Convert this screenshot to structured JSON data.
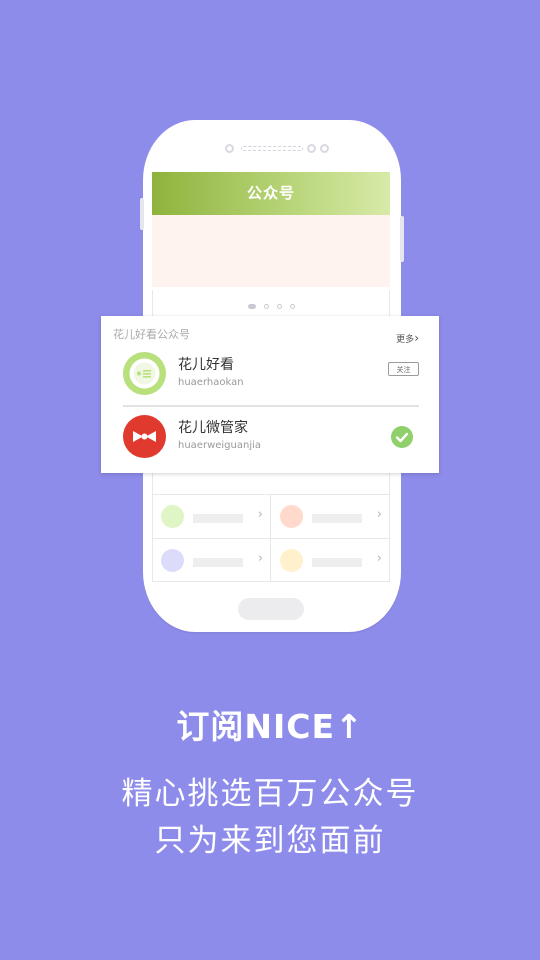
{
  "phone_screen": {
    "title": "公众号"
  },
  "card": {
    "section_title": "花儿好看公众号",
    "more_label": "更多",
    "accounts": [
      {
        "name": "花儿好看",
        "handle": "huaerhaokan",
        "action_label": "关注",
        "followed": false
      },
      {
        "name": "花儿微管家",
        "handle": "huaerweiguanjia",
        "followed": true
      }
    ]
  },
  "headline": "订阅NICE↑",
  "subtitle_lines": [
    "精心挑选百万公众号",
    "只为来到您面前"
  ],
  "colors": {
    "background": "#8e8cea",
    "title_bar_start": "#8fb33d",
    "title_bar_end": "#d8eaa8",
    "accent_green": "#8fd06a",
    "account_red": "#e03a2e"
  }
}
